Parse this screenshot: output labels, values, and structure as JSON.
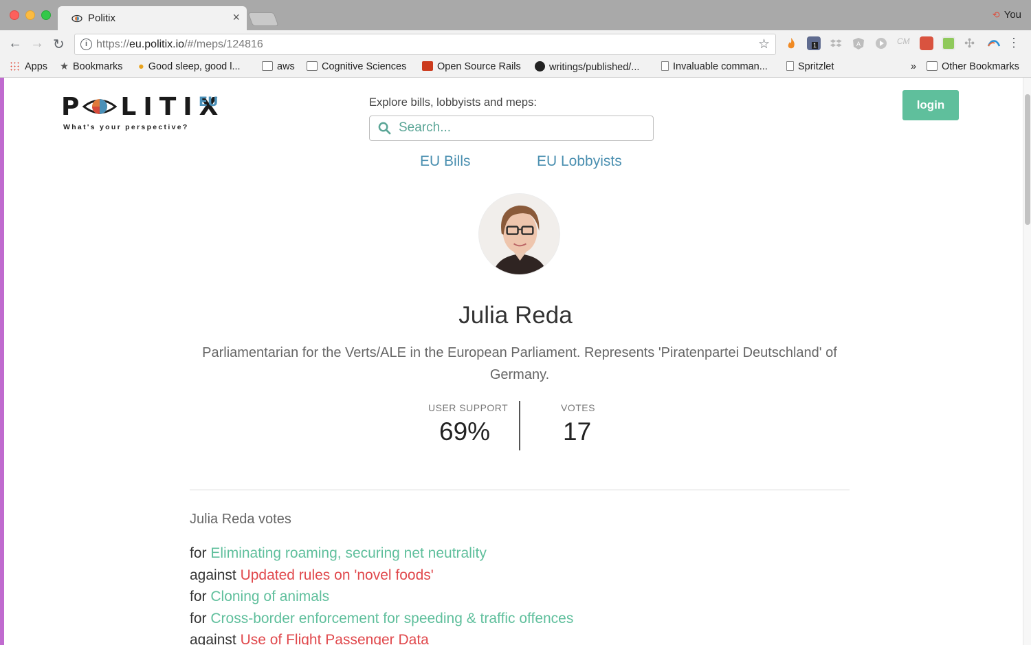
{
  "browser": {
    "tab_title": "Politix",
    "tab_close": "×",
    "profile_name": "You",
    "url_scheme": "https://",
    "url_host": "eu.politix.io",
    "url_path": "/#/meps/124816",
    "bookmarks": [
      {
        "label": "Apps",
        "icon": "apps-grid-icon"
      },
      {
        "label": "Bookmarks",
        "icon": "star-icon"
      },
      {
        "label": "Good sleep, good l...",
        "icon": "lightbulb-icon"
      },
      {
        "label": "aws",
        "icon": "folder-icon"
      },
      {
        "label": "Cognitive Sciences",
        "icon": "folder-icon"
      },
      {
        "label": "Open Source Rails",
        "icon": "rails-icon"
      },
      {
        "label": "writings/published/...",
        "icon": "github-icon"
      },
      {
        "label": "Invaluable comman...",
        "icon": "file-icon"
      },
      {
        "label": "Spritzlet",
        "icon": "file-icon"
      }
    ],
    "overflow": "»",
    "other_bookmarks": "Other Bookmarks",
    "extension_badge": "1"
  },
  "site": {
    "logo_text": "POLITIX",
    "logo_suffix": "EU",
    "logo_tagline": "What's your perspective?",
    "explore_label": "Explore bills, lobbyists and meps:",
    "search_placeholder": "Search...",
    "nav": [
      {
        "label": "EU Bills"
      },
      {
        "label": "EU Lobbyists"
      }
    ],
    "login_label": "login"
  },
  "mep": {
    "name": "Julia Reda",
    "description": "Parliamentarian for the Verts/ALE in the European Parliament. Represents 'Piratenpartei Deutschland' of Germany.",
    "stats": [
      {
        "label": "USER SUPPORT",
        "value": "69%"
      },
      {
        "label": "VOTES",
        "value": "17"
      }
    ],
    "votes_heading": "Julia Reda votes",
    "votes": [
      {
        "position": "for",
        "bill": "Eliminating roaming, securing net neutrality"
      },
      {
        "position": "against",
        "bill": "Updated rules on 'novel foods'"
      },
      {
        "position": "for",
        "bill": "Cloning of animals"
      },
      {
        "position": "for",
        "bill": "Cross-border enforcement for speeding & traffic offences"
      },
      {
        "position": "against",
        "bill": "Use of Flight Passenger Data"
      }
    ]
  },
  "colors": {
    "accent_green": "#5fbf9c",
    "against_red": "#e0484c",
    "link_blue": "#4a8fb0",
    "page_accent": "#c06bcf"
  }
}
